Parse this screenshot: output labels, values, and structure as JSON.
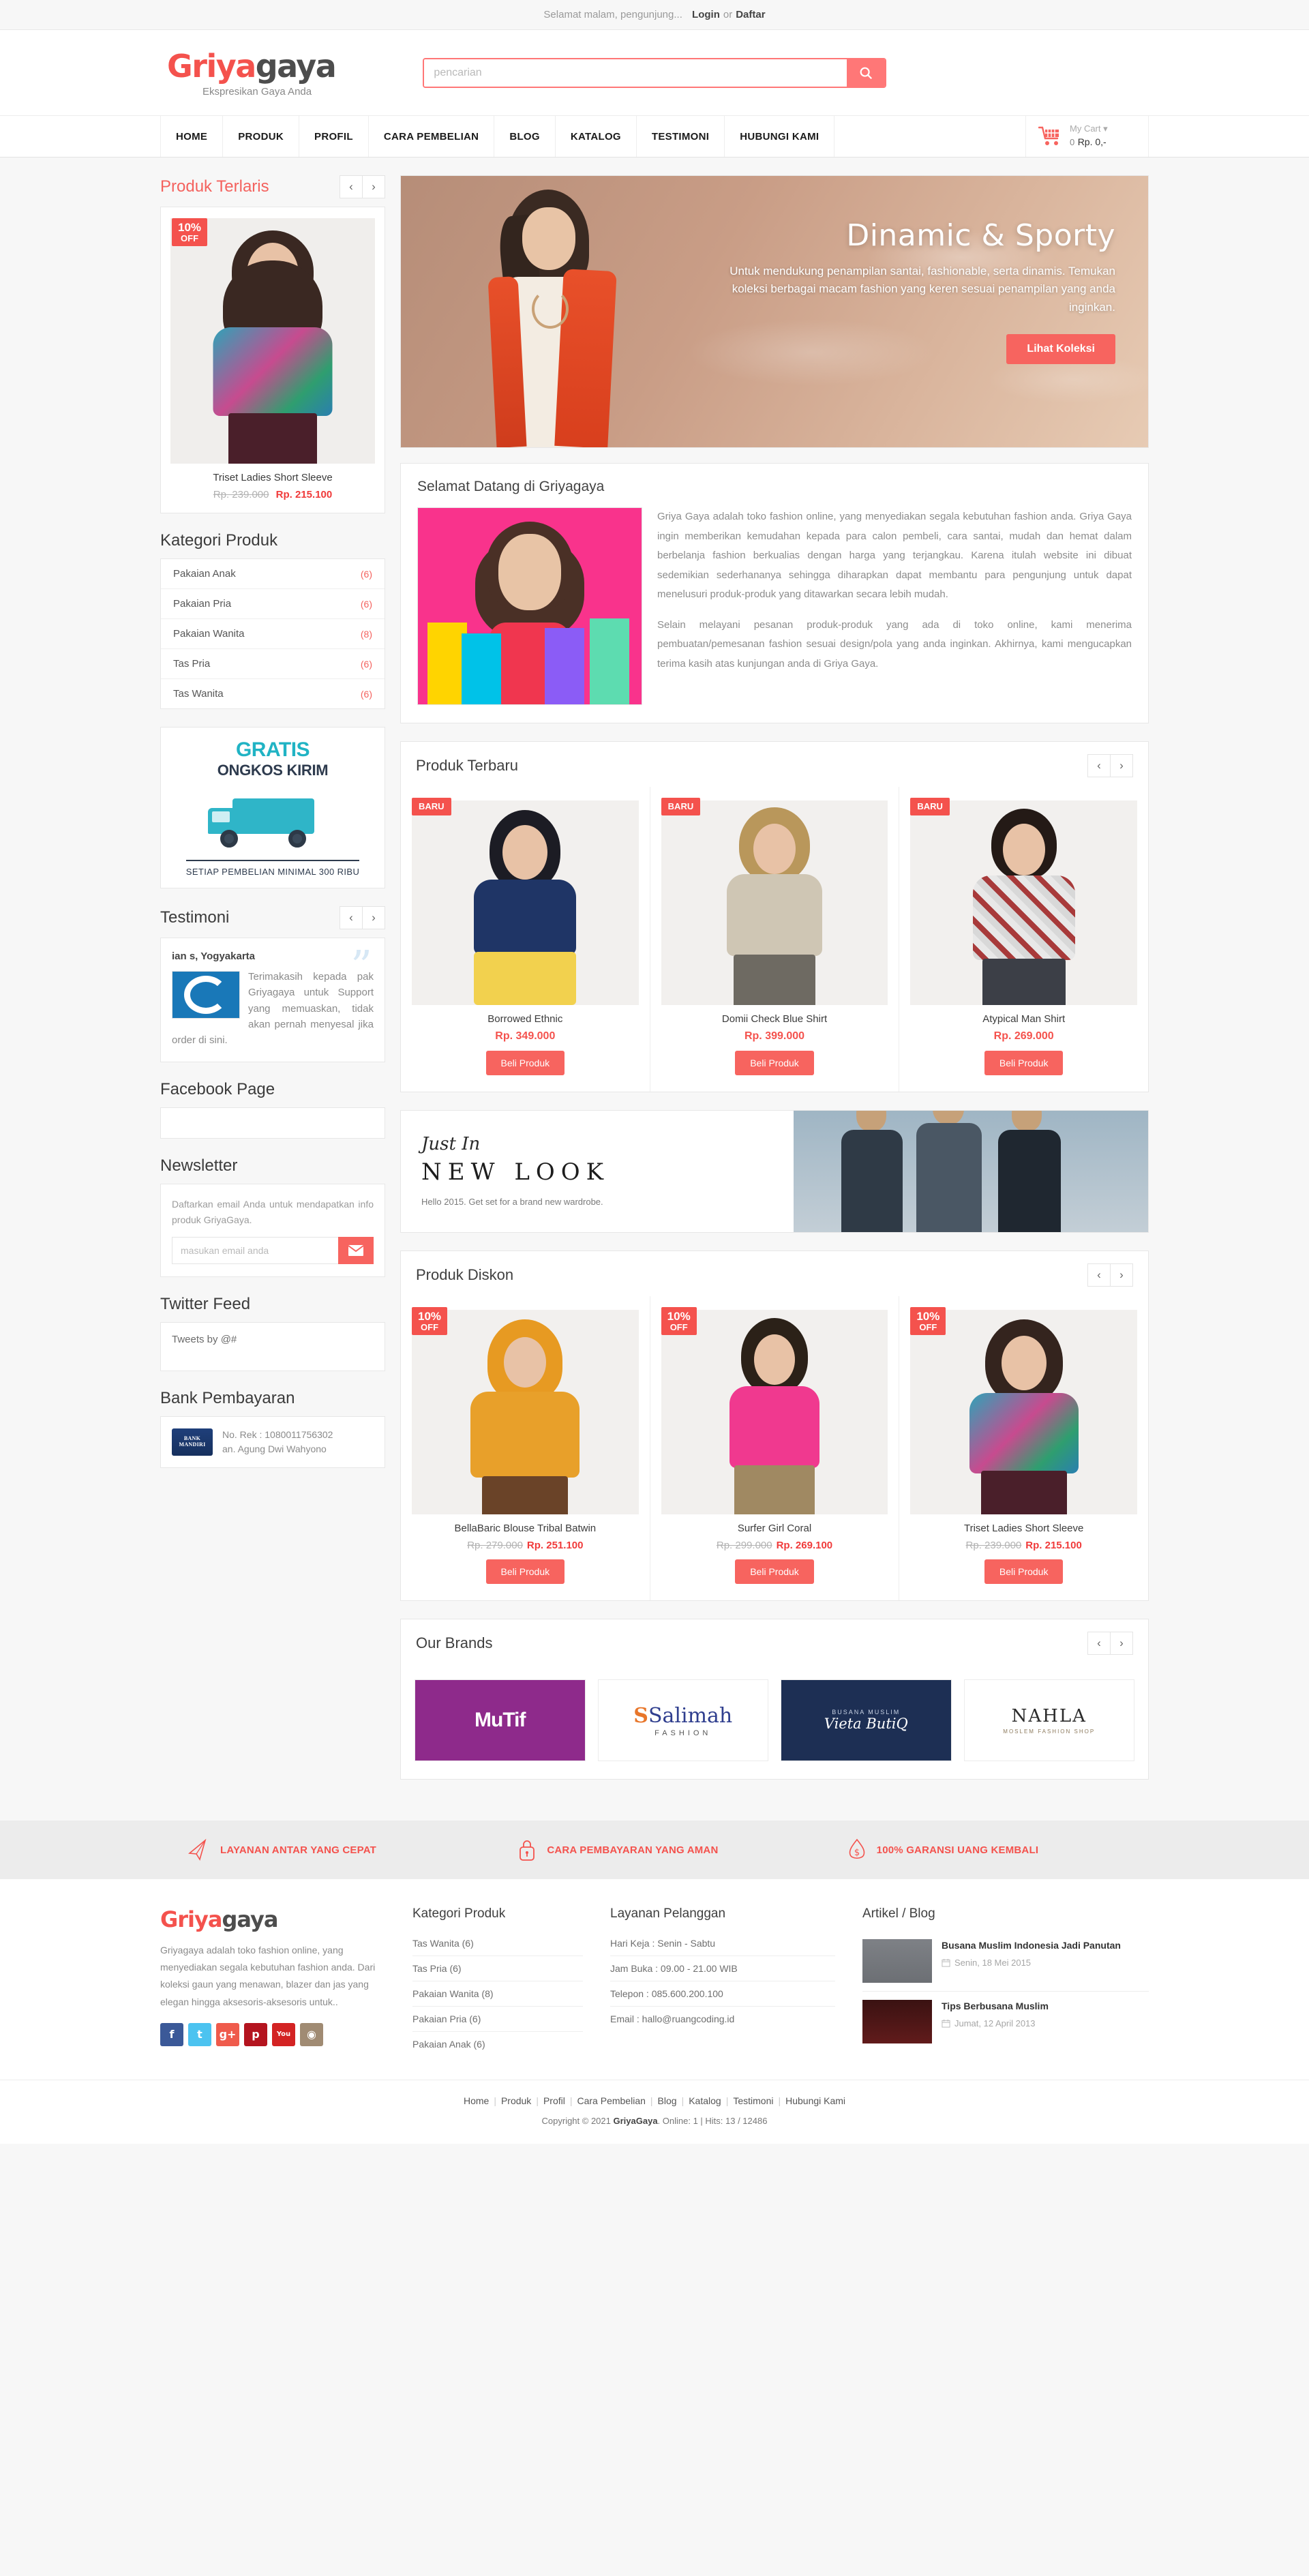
{
  "topbar": {
    "greeting": "Selamat malam, pengunjung...",
    "login": "Login",
    "or": "or",
    "register": "Daftar"
  },
  "header": {
    "logo_part1": "Griya",
    "logo_part2": "gaya",
    "tagline": "Ekspresikan Gaya Anda",
    "search_placeholder": "pencarian",
    "search_value": ""
  },
  "nav": {
    "items": [
      {
        "label": "HOME"
      },
      {
        "label": "PRODUK"
      },
      {
        "label": "PROFIL"
      },
      {
        "label": "CARA PEMBELIAN"
      },
      {
        "label": "BLOG"
      },
      {
        "label": "KATALOG"
      },
      {
        "label": "TESTIMONI"
      },
      {
        "label": "HUBUNGI KAMI"
      }
    ],
    "cart": {
      "title": "My Cart",
      "caret": "▾",
      "count": "0",
      "total": "Rp. 0,-"
    }
  },
  "sidebar": {
    "best_seller": {
      "title": "Produk Terlaris",
      "prev": "‹",
      "next": "›",
      "product": {
        "badge_percent": "10%",
        "badge_off": "OFF",
        "name": "Triset Ladies Short Sleeve",
        "price_old": "Rp. 239.000",
        "price_new": "Rp. 215.100"
      }
    },
    "categories": {
      "title": "Kategori Produk",
      "items": [
        {
          "label": "Pakaian Anak",
          "count": "(6)"
        },
        {
          "label": "Pakaian Pria",
          "count": "(6)"
        },
        {
          "label": "Pakaian Wanita",
          "count": "(8)"
        },
        {
          "label": "Tas Pria",
          "count": "(6)"
        },
        {
          "label": "Tas Wanita",
          "count": "(6)"
        }
      ]
    },
    "ongkir": {
      "line1": "GRATIS",
      "line2": "ONGKOS KIRIM",
      "line3": "SETIAP PEMBELIAN MINIMAL 300 RIBU"
    },
    "testimonial": {
      "title": "Testimoni",
      "prev": "‹",
      "next": "›",
      "author": "ian s, Yogyakarta",
      "quote_glyph": "”",
      "body": "Terimakasih kepada pak Griyagaya untuk Support yang memuaskan, tidak akan pernah menyesal jika order di sini."
    },
    "facebook": {
      "title": "Facebook Page"
    },
    "newsletter": {
      "title": "Newsletter",
      "text": "Daftarkan email Anda untuk mendapatkan info produk GriyaGaya.",
      "placeholder": "masukan email anda",
      "value": ""
    },
    "twitter": {
      "title": "Twitter Feed",
      "body": "Tweets by @#"
    },
    "bank": {
      "title": "Bank Pembayaran",
      "logo_line1": "BANK",
      "logo_line2": "MANDIRI",
      "account": "No. Rek : 1080011756302",
      "holder": "an. Agung Dwi Wahyono"
    }
  },
  "hero": {
    "title": "Dinamic & Sporty",
    "subtitle": "Untuk mendukung penampilan santai, fashionable, serta dinamis. Temukan koleksi berbagai macam fashion yang keren sesuai penampilan yang anda inginkan.",
    "button": "Lihat Koleksi"
  },
  "welcome": {
    "title": "Selamat Datang di Griyagaya",
    "paragraph1": "Griya Gaya adalah toko fashion online, yang menyediakan segala kebutuhan fashion anda. Griya Gaya  ingin memberikan kemudahan kepada para calon pembeli, cara santai, mudah dan hemat dalam berbelanja fashion berkualias dengan harga yang terjangkau. Karena itulah website ini dibuat sedemikian sederhananya sehingga diharapkan dapat membantu para pengunjung untuk dapat menelusuri produk-produk yang ditawarkan secara lebih mudah.",
    "paragraph2": "Selain melayani pesanan produk-produk yang ada di toko online, kami menerima pembuatan/pemesanan fashion sesuai design/pola  yang anda inginkan. Akhirnya, kami mengucapkan terima kasih atas kunjungan anda di Griya Gaya."
  },
  "new_products": {
    "title": "Produk Terbaru",
    "prev": "‹",
    "next": "›",
    "buy_label": "Beli Produk",
    "badge": "BARU",
    "items": [
      {
        "name": "Borrowed Ethnic",
        "price": "Rp. 349.000"
      },
      {
        "name": "Domii Check Blue Shirt",
        "price": "Rp. 399.000"
      },
      {
        "name": "Atypical Man Shirt",
        "price": "Rp. 269.000"
      }
    ]
  },
  "newlook": {
    "just_in": "Just In",
    "headline": "NEW LOOK",
    "text": "Hello 2015. Get set for a brand new wardrobe."
  },
  "discount_products": {
    "title": "Produk Diskon",
    "prev": "‹",
    "next": "›",
    "buy_label": "Beli Produk",
    "badge_percent": "10%",
    "badge_off": "OFF",
    "items": [
      {
        "name": "BellaBaric Blouse Tribal Batwin",
        "price_old": "Rp. 279.000",
        "price_new": "Rp. 251.100"
      },
      {
        "name": "Surfer Girl Coral",
        "price_old": "Rp. 299.000",
        "price_new": "Rp. 269.100"
      },
      {
        "name": "Triset Ladies Short Sleeve",
        "price_old": "Rp. 239.000",
        "price_new": "Rp. 215.100"
      }
    ]
  },
  "brands": {
    "title": "Our Brands",
    "prev": "‹",
    "next": "›",
    "items": [
      {
        "name": "MuTif"
      },
      {
        "name": "Salimah",
        "sub": "FASHION"
      },
      {
        "name": "Vieta ButiQ",
        "sub": "BUSANA MUSLIM"
      },
      {
        "name": "NAHLA",
        "sub": "MOSLEM FASHION SHOP"
      }
    ]
  },
  "features": [
    {
      "icon": "paper-plane-icon",
      "label": "LAYANAN ANTAR YANG CEPAT"
    },
    {
      "icon": "lock-icon",
      "label": "CARA PEMBAYARAN YANG AMAN"
    },
    {
      "icon": "money-guarantee-icon",
      "label": "100% GARANSI UANG KEMBALI"
    }
  ],
  "footer": {
    "logo_part1": "Griya",
    "logo_part2": "gaya",
    "description": "Griyagaya adalah toko fashion online, yang menyediakan segala kebutuhan fashion anda. Dari koleksi gaun yang menawan, blazer dan jas yang elegan hingga aksesoris-aksesoris untuk..",
    "socials": [
      {
        "name": "facebook",
        "glyph": "f",
        "color": "#3b5998"
      },
      {
        "name": "twitter",
        "glyph": "t",
        "color": "#4cc3f0"
      },
      {
        "name": "google-plus",
        "glyph": "g+",
        "color": "#ef5b4c"
      },
      {
        "name": "pinterest",
        "glyph": "p",
        "color": "#b4141f"
      },
      {
        "name": "youtube",
        "glyph": "You",
        "color": "#d32323"
      },
      {
        "name": "instagram",
        "glyph": "◉",
        "color": "#a08b73"
      }
    ],
    "categories": {
      "title": "Kategori Produk",
      "items": [
        {
          "label": "Tas Wanita  (6)"
        },
        {
          "label": "Tas Pria  (6)"
        },
        {
          "label": "Pakaian Wanita  (8)"
        },
        {
          "label": "Pakaian Pria  (6)"
        },
        {
          "label": "Pakaian Anak  (6)"
        }
      ]
    },
    "service": {
      "title": "Layanan Pelanggan",
      "items": [
        {
          "label": "Hari Keja : Senin - Sabtu"
        },
        {
          "label": "Jam Buka : 09.00 - 21.00 WIB"
        },
        {
          "label": "Telepon : 085.600.200.100"
        },
        {
          "label": "Email : hallo@ruangcoding.id"
        }
      ]
    },
    "blog": {
      "title": "Artikel / Blog",
      "items": [
        {
          "title": "Busana Muslim Indonesia Jadi Panutan",
          "date": "Senin, 18 Mei 2015"
        },
        {
          "title": "Tips Berbusana Muslim",
          "date": "Jumat, 12 April 2013"
        }
      ]
    }
  },
  "copybar": {
    "links": [
      "Home",
      "Produk",
      "Profil",
      "Cara Pembelian",
      "Blog",
      "Katalog",
      "Testimoni",
      "Hubungi Kami"
    ],
    "copyright_pre": "Copyright © 2021 ",
    "brand": "GriyaGaya",
    "copyright_post": ". Online: 1 | Hits: 13 / 12486"
  },
  "colors": {
    "accent": "#f7645f",
    "accent_dark": "#f4524d",
    "price_red": "#f03a3a"
  }
}
